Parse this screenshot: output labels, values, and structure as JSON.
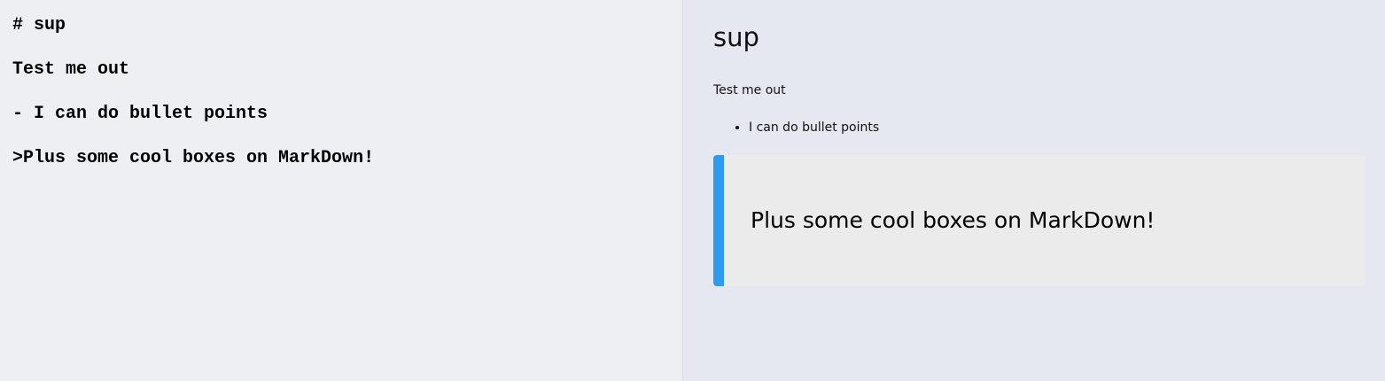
{
  "editor": {
    "content": "# sup\n\nTest me out\n\n- I can do bullet points\n\n>Plus some cool boxes on MarkDown!"
  },
  "preview": {
    "title": "sup",
    "paragraph": "Test me out",
    "list_items": [
      "I can do bullet points"
    ],
    "blockquote": "Plus some cool boxes on MarkDown!"
  },
  "colors": {
    "editor_background": "#eeeff3",
    "preview_background": "#e5e8f0",
    "quote_background": "#ebebeb",
    "quote_accent": "#2f9bf0"
  }
}
